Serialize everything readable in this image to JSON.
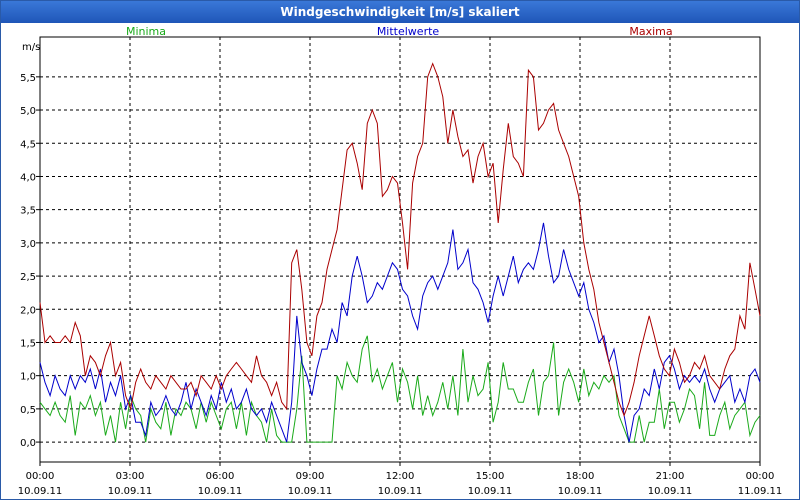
{
  "window": {
    "title": "Windgeschwindigkeit [m/s] skaliert"
  },
  "chart_data": {
    "type": "line",
    "title": "Windgeschwindigkeit [m/s] skaliert",
    "ylabel": "m/s",
    "xlabel": "",
    "ylim": [
      -0.3,
      6.1
    ],
    "yticks": [
      0.0,
      0.5,
      1.0,
      1.5,
      2.0,
      2.5,
      3.0,
      3.5,
      4.0,
      4.5,
      5.0,
      5.5
    ],
    "ytick_labels": [
      "0,0",
      "0,5",
      "1,0",
      "1,5",
      "2,0",
      "2,5",
      "3,0",
      "3,5",
      "4,0",
      "4,5",
      "5,0",
      "5,5"
    ],
    "xlim": [
      0,
      24
    ],
    "xticks": [
      {
        "hour": 0,
        "time": "00:00",
        "date": "10.09.11"
      },
      {
        "hour": 3,
        "time": "03:00",
        "date": "10.09.11"
      },
      {
        "hour": 6,
        "time": "06:00",
        "date": "10.09.11"
      },
      {
        "hour": 9,
        "time": "09:00",
        "date": "10.09.11"
      },
      {
        "hour": 12,
        "time": "12:00",
        "date": "10.09.11"
      },
      {
        "hour": 15,
        "time": "15:00",
        "date": "10.09.11"
      },
      {
        "hour": 18,
        "time": "18:00",
        "date": "10.09.11"
      },
      {
        "hour": 21,
        "time": "21:00",
        "date": "10.09.11"
      },
      {
        "hour": 24,
        "time": "00:00",
        "date": "11.09.11"
      }
    ],
    "grid": true,
    "x": [
      0,
      1,
      2,
      3,
      4,
      5,
      6,
      7,
      8,
      9,
      10,
      11,
      12,
      13,
      14,
      15,
      16,
      17,
      18,
      19,
      20,
      21,
      22,
      23,
      24,
      25,
      26,
      27,
      28,
      29,
      30,
      31,
      32,
      33,
      34,
      35,
      36,
      37,
      38,
      39,
      40,
      41,
      42,
      43,
      44,
      45,
      46,
      47,
      48,
      49,
      50,
      51,
      52,
      53,
      54,
      55,
      56,
      57,
      58,
      59,
      60,
      61,
      62,
      63,
      64,
      65,
      66,
      67,
      68,
      69,
      70,
      71,
      72,
      73,
      74,
      75,
      76,
      77,
      78,
      79,
      80,
      81,
      82,
      83,
      84,
      85,
      86,
      87,
      88,
      89,
      90,
      91,
      92,
      93,
      94,
      95,
      96,
      97,
      98,
      99,
      100,
      101,
      102,
      103,
      104,
      105,
      106,
      107,
      108,
      109,
      110,
      111,
      112,
      113,
      114,
      115,
      116,
      117,
      118,
      119,
      120,
      121,
      122,
      123,
      124,
      125,
      126,
      127,
      128,
      129,
      130,
      131,
      132,
      133,
      134,
      135,
      136,
      137,
      138,
      139,
      140,
      141,
      142,
      143
    ],
    "x_unit_note": "",
    "series": [
      {
        "name": "Minima",
        "color": "#1aaa1a",
        "values": [
          0.6,
          0.5,
          0.4,
          0.6,
          0.4,
          0.3,
          0.7,
          0.1,
          0.6,
          0.5,
          0.7,
          0.4,
          0.6,
          0.1,
          0.4,
          0.0,
          0.6,
          0.2,
          0.7,
          0.5,
          0.4,
          0.0,
          0.5,
          0.3,
          0.2,
          0.6,
          0.1,
          0.5,
          0.4,
          0.6,
          0.5,
          0.2,
          0.6,
          0.3,
          0.6,
          0.4,
          0.2,
          0.5,
          0.6,
          0.2,
          0.6,
          0.1,
          0.6,
          0.4,
          0.3,
          0.0,
          0.5,
          0.1,
          0.0,
          0.0,
          0.0,
          0.5,
          1.3,
          0.0,
          0.0,
          0.0,
          0.0,
          0.0,
          0.0,
          1.0,
          0.8,
          1.2,
          1.0,
          0.9,
          1.4,
          1.6,
          0.9,
          1.1,
          0.8,
          1.0,
          1.2,
          0.6,
          1.1,
          0.9,
          0.5,
          1.0,
          0.4,
          0.7,
          0.4,
          0.6,
          0.9,
          0.5,
          1.0,
          0.4,
          1.4,
          0.6,
          1.0,
          0.7,
          0.8,
          1.2,
          0.3,
          0.6,
          1.2,
          0.8,
          0.8,
          0.6,
          0.6,
          0.9,
          1.1,
          0.4,
          0.9,
          1.0,
          1.5,
          0.4,
          0.9,
          1.1,
          0.9,
          0.6,
          1.1,
          0.7,
          0.9,
          0.8,
          1.0,
          0.9,
          1.0,
          0.4,
          0.2,
          0.0,
          0.0,
          0.4,
          0.0,
          0.3,
          0.3,
          0.8,
          0.2,
          0.6,
          0.6,
          0.3,
          0.5,
          0.8,
          0.7,
          0.2,
          0.9,
          0.1,
          0.1,
          0.4,
          0.6,
          0.2,
          0.4,
          0.5,
          0.6,
          0.1,
          0.3,
          0.4
        ]
      },
      {
        "name": "Mittelwerte",
        "color": "#0000cc",
        "values": [
          1.2,
          0.9,
          0.7,
          1.0,
          0.8,
          0.7,
          1.0,
          0.8,
          1.0,
          0.9,
          1.1,
          0.8,
          1.1,
          0.6,
          0.9,
          0.7,
          1.0,
          0.5,
          0.7,
          0.3,
          0.3,
          0.1,
          0.6,
          0.4,
          0.5,
          0.7,
          0.5,
          0.4,
          0.6,
          0.9,
          0.5,
          0.8,
          0.6,
          0.4,
          0.7,
          0.5,
          0.9,
          0.6,
          0.8,
          0.5,
          0.6,
          0.8,
          0.5,
          0.4,
          0.5,
          0.3,
          0.6,
          0.4,
          0.2,
          0.0,
          0.6,
          1.9,
          1.2,
          1.0,
          0.7,
          1.1,
          1.4,
          1.4,
          1.7,
          1.5,
          2.1,
          1.9,
          2.5,
          2.8,
          2.5,
          2.1,
          2.2,
          2.4,
          2.3,
          2.5,
          2.7,
          2.6,
          2.3,
          2.2,
          1.9,
          1.7,
          2.2,
          2.4,
          2.5,
          2.3,
          2.5,
          2.7,
          3.2,
          2.6,
          2.7,
          2.9,
          2.4,
          2.3,
          2.1,
          1.8,
          2.2,
          2.5,
          2.2,
          2.5,
          2.8,
          2.4,
          2.6,
          2.7,
          2.6,
          2.9,
          3.3,
          2.8,
          2.4,
          2.5,
          2.9,
          2.6,
          2.4,
          2.2,
          2.4,
          2.0,
          1.8,
          1.5,
          1.6,
          1.2,
          1.4,
          1.0,
          0.4,
          0.0,
          0.4,
          0.5,
          0.8,
          0.7,
          1.1,
          0.8,
          1.2,
          1.3,
          1.1,
          0.8,
          1.0,
          0.9,
          1.0,
          0.9,
          1.1,
          0.8,
          0.6,
          0.8,
          0.9,
          1.0,
          0.6,
          0.8,
          0.6,
          1.0,
          1.1,
          0.9
        ]
      },
      {
        "name": "Maxima",
        "color": "#aa0000",
        "values": [
          2.1,
          1.5,
          1.6,
          1.5,
          1.5,
          1.6,
          1.5,
          1.8,
          1.6,
          1.0,
          1.3,
          1.2,
          1.0,
          1.3,
          1.5,
          1.0,
          1.2,
          0.7,
          0.5,
          0.9,
          1.1,
          0.9,
          0.8,
          1.0,
          0.9,
          0.8,
          1.0,
          0.9,
          0.8,
          0.8,
          0.9,
          0.7,
          1.0,
          0.9,
          0.8,
          1.0,
          0.8,
          1.0,
          1.1,
          1.2,
          1.1,
          1.0,
          0.9,
          1.3,
          1.0,
          0.9,
          0.7,
          0.9,
          0.6,
          0.5,
          2.7,
          2.9,
          2.3,
          1.5,
          1.3,
          1.9,
          2.1,
          2.6,
          2.9,
          3.2,
          3.8,
          4.4,
          4.5,
          4.2,
          3.8,
          4.8,
          5.0,
          4.8,
          3.7,
          3.8,
          4.0,
          3.9,
          3.3,
          2.6,
          3.9,
          4.3,
          4.5,
          5.5,
          5.7,
          5.5,
          5.2,
          4.5,
          5.0,
          4.6,
          4.3,
          4.4,
          3.9,
          4.3,
          4.5,
          4.0,
          4.2,
          3.3,
          4.1,
          4.8,
          4.3,
          4.2,
          4.0,
          5.6,
          5.5,
          4.7,
          4.8,
          5.0,
          5.1,
          4.7,
          4.5,
          4.3,
          4.0,
          3.7,
          3.0,
          2.6,
          2.3,
          1.8,
          1.5,
          1.2,
          0.9,
          0.6,
          0.4,
          0.6,
          0.9,
          1.3,
          1.6,
          1.9,
          1.6,
          1.3,
          1.1,
          1.0,
          1.4,
          1.2,
          0.9,
          1.0,
          1.2,
          1.1,
          1.3,
          1.0,
          0.9,
          0.8,
          1.1,
          1.3,
          1.4,
          1.9,
          1.7,
          2.7,
          2.3,
          1.9
        ]
      }
    ]
  }
}
